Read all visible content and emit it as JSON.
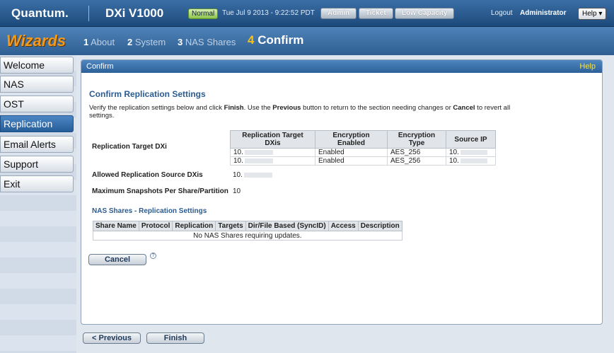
{
  "header": {
    "brand": "Quantum.",
    "product": "DX⁠i V1000",
    "status_badge": "Normal",
    "datetime": "Tue Jul 9 2013 - 9:22:52 PDT",
    "admin_label": "Admin",
    "ticket_label": "Ticket",
    "capacity_label": "Low Capacity",
    "logout_label": "Logout",
    "user": "Administrator",
    "help_label": "Help ▾"
  },
  "wizard": {
    "title": "Wizards",
    "steps": [
      {
        "num": "1",
        "label": "About"
      },
      {
        "num": "2",
        "label": "System"
      },
      {
        "num": "3",
        "label": "NAS Shares"
      },
      {
        "num": "4",
        "label": "Confirm"
      }
    ]
  },
  "sidebar": {
    "items": [
      {
        "label": "Welcome"
      },
      {
        "label": "NAS"
      },
      {
        "label": "OST"
      },
      {
        "label": "Replication"
      },
      {
        "label": "Email Alerts"
      },
      {
        "label": "Support"
      },
      {
        "label": "Exit"
      }
    ]
  },
  "panel": {
    "header": "Confirm",
    "help": "Help",
    "title": "Confirm Replication Settings",
    "desc_1": "Verify the replication settings below and click ",
    "desc_finish": "Finish",
    "desc_2": ". Use the ",
    "desc_previous": "Previous",
    "desc_3": " button to return to the section needing changes or ",
    "desc_cancel": "Cancel",
    "desc_4": " to revert all settings.",
    "target_label": "Replication Target DXi",
    "target_table": {
      "headers": [
        "Replication Target DXis",
        "Encryption Enabled",
        "Encryption Type",
        "Source IP"
      ],
      "rows": [
        [
          "10.",
          "Enabled",
          "AES_256",
          "10."
        ],
        [
          "10.",
          "Enabled",
          "AES_256",
          "10."
        ]
      ]
    },
    "allowed_label": "Allowed Replication Source DXis",
    "allowed_value": "10.",
    "max_snap_label": "Maximum Snapshots Per Share/Partition",
    "max_snap_value": "10",
    "nas_title": "NAS Shares - Replication Settings",
    "nas_table": {
      "headers": [
        "Share Name",
        "Protocol",
        "Replication",
        "Targets",
        "Dir/File Based (SyncID)",
        "Access",
        "Description"
      ],
      "empty": "No NAS Shares requiring updates."
    },
    "cancel_label": "Cancel",
    "help_icon": "?"
  },
  "footer": {
    "previous_label": "< Previous",
    "finish_label": "Finish"
  }
}
